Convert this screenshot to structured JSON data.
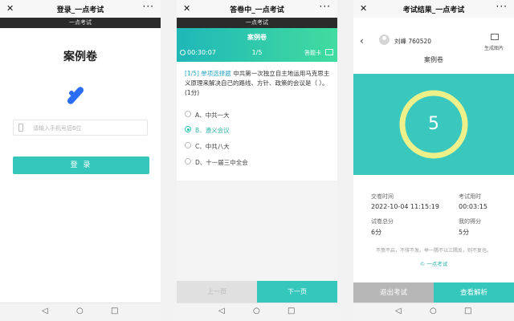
{
  "nav_icons": [
    "back-triangle-icon",
    "home-circle-icon",
    "recent-square-icon"
  ],
  "colors": {
    "accent": "#35c7bb",
    "header_gradient": [
      "#1fb7b8",
      "#41dc9f"
    ],
    "logo": "#2a6ef5",
    "dark_bar": "#2b2b2b",
    "ring": "#eef08a"
  },
  "login": {
    "window_title": "登录_一点考试",
    "brand": "一点考试",
    "exam_name": "案例卷",
    "input_placeholder": "请输入手机号后6位",
    "login_button": "登 录"
  },
  "exam": {
    "window_title": "答卷中_一点考试",
    "brand": "一点考试",
    "exam_name": "案例卷",
    "elapsed_time": "00:30:07",
    "progress": "1/5",
    "answer_card": "答题卡",
    "question_type": "[1/5] 单项选择题",
    "question_text": "中共第一次独立自主地运用马克思主义原理来解决自己的路线、方针、政策的会议是（     ）。(1分)",
    "options": [
      {
        "letter": "A",
        "text": "A、中共一大",
        "selected": false
      },
      {
        "letter": "B",
        "text": "B、遵义会议",
        "selected": true
      },
      {
        "letter": "C",
        "text": "C、中共八大",
        "selected": false
      },
      {
        "letter": "D",
        "text": "D、十一届三中全会",
        "selected": false
      }
    ],
    "prev_button": "上一页",
    "next_button": "下一页"
  },
  "result": {
    "window_title": "考试结果_一点考试",
    "username": "刘峰 760520",
    "generate_image": "生成图片",
    "exam_name": "案例卷",
    "score": "5",
    "score_fraction": 1.0,
    "submit_time_label": "交卷时间",
    "submit_time": "2022-10-04 11:15:19",
    "duration_label": "考试用时",
    "duration": "00:03:15",
    "total_label": "试卷总分",
    "total": "6分",
    "my_score_label": "我的得分",
    "my_score": "5分",
    "motto": "不愤不启，不悱不发。举一隅不以三隅反，则不复也。",
    "copyright": "© 一点考试",
    "exit_button": "退出考试",
    "analysis_button": "查看解析"
  }
}
